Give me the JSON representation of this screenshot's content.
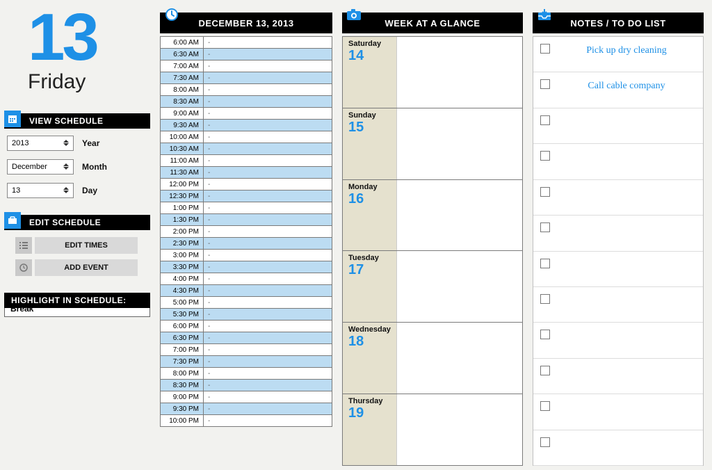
{
  "date": {
    "number": "13",
    "dayName": "Friday"
  },
  "left": {
    "viewSchedule": {
      "header": "VIEW SCHEDULE",
      "year": {
        "value": "2013",
        "label": "Year"
      },
      "month": {
        "value": "December",
        "label": "Month"
      },
      "day": {
        "value": "13",
        "label": "Day"
      }
    },
    "editSchedule": {
      "header": "EDIT SCHEDULE",
      "editTimes": "EDIT TIMES",
      "addEvent": "ADD EVENT"
    },
    "highlight": {
      "header": "HIGHLIGHT IN SCHEDULE:",
      "value": "Break"
    }
  },
  "scheduleHeader": "DECEMBER 13, 2013",
  "scheduleSlots": [
    {
      "t": "6:00 AM",
      "v": "-"
    },
    {
      "t": "6:30 AM",
      "v": "-"
    },
    {
      "t": "7:00 AM",
      "v": "-"
    },
    {
      "t": "7:30 AM",
      "v": "-"
    },
    {
      "t": "8:00 AM",
      "v": "-"
    },
    {
      "t": "8:30 AM",
      "v": "-"
    },
    {
      "t": "9:00 AM",
      "v": "-"
    },
    {
      "t": "9:30 AM",
      "v": "-"
    },
    {
      "t": "10:00 AM",
      "v": "-"
    },
    {
      "t": "10:30 AM",
      "v": "-"
    },
    {
      "t": "11:00 AM",
      "v": "-"
    },
    {
      "t": "11:30 AM",
      "v": "-"
    },
    {
      "t": "12:00 PM",
      "v": "-"
    },
    {
      "t": "12:30 PM",
      "v": "-"
    },
    {
      "t": "1:00 PM",
      "v": "-"
    },
    {
      "t": "1:30 PM",
      "v": "-"
    },
    {
      "t": "2:00 PM",
      "v": "-"
    },
    {
      "t": "2:30 PM",
      "v": "-"
    },
    {
      "t": "3:00 PM",
      "v": "-"
    },
    {
      "t": "3:30 PM",
      "v": "-"
    },
    {
      "t": "4:00 PM",
      "v": "-"
    },
    {
      "t": "4:30 PM",
      "v": "-"
    },
    {
      "t": "5:00 PM",
      "v": "-"
    },
    {
      "t": "5:30 PM",
      "v": "-"
    },
    {
      "t": "6:00 PM",
      "v": "-"
    },
    {
      "t": "6:30 PM",
      "v": "-"
    },
    {
      "t": "7:00 PM",
      "v": "-"
    },
    {
      "t": "7:30 PM",
      "v": "-"
    },
    {
      "t": "8:00 PM",
      "v": "-"
    },
    {
      "t": "8:30 PM",
      "v": "-"
    },
    {
      "t": "9:00 PM",
      "v": "-"
    },
    {
      "t": "9:30 PM",
      "v": "-"
    },
    {
      "t": "10:00 PM",
      "v": "-"
    }
  ],
  "weekHeader": "WEEK AT A GLANCE",
  "weekDays": [
    {
      "name": "Saturday",
      "num": "14"
    },
    {
      "name": "Sunday",
      "num": "15"
    },
    {
      "name": "Monday",
      "num": "16"
    },
    {
      "name": "Tuesday",
      "num": "17"
    },
    {
      "name": "Wednesday",
      "num": "18"
    },
    {
      "name": "Thursday",
      "num": "19"
    }
  ],
  "notesHeader": "NOTES / TO DO LIST",
  "notes": [
    {
      "text": "Pick up dry cleaning"
    },
    {
      "text": "Call cable company"
    },
    {
      "text": ""
    },
    {
      "text": ""
    },
    {
      "text": ""
    },
    {
      "text": ""
    },
    {
      "text": ""
    },
    {
      "text": ""
    },
    {
      "text": ""
    },
    {
      "text": ""
    },
    {
      "text": ""
    },
    {
      "text": ""
    }
  ]
}
